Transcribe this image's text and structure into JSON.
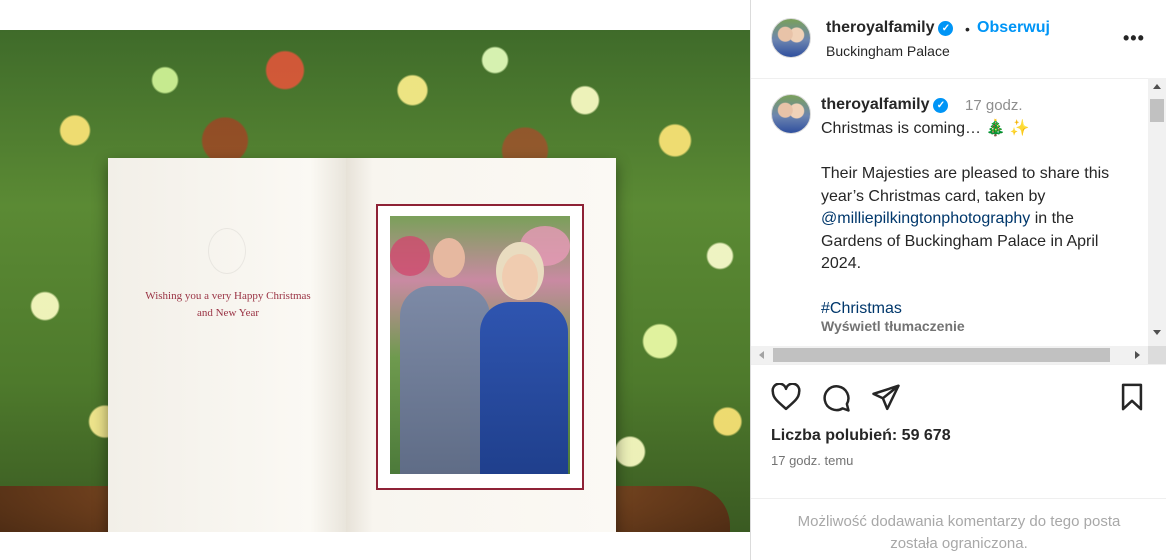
{
  "post": {
    "author": "theroyalfamily",
    "location": "Buckingham Palace",
    "follow_label": "Obserwuj",
    "dot": "•",
    "more_label": "•••",
    "verified_glyph": "✓"
  },
  "card": {
    "line1": "Wishing you a very Happy Christmas",
    "line2": "and New Year"
  },
  "caption": {
    "author": "theroyalfamily",
    "time": "17 godz.",
    "line1": "Christmas is coming… 🎄 ✨",
    "para_text": "Their Majesties are pleased to share this year’s Christmas card, taken by ",
    "mention": "@milliepilkingtonphotography",
    "para_end": " in the Gardens of Buckingham Palace in April 2024.",
    "hashtag": "#Christmas",
    "translate_label": "Wyświetl tłumaczenie"
  },
  "engagement": {
    "likes": "Liczba polubień: 59 678",
    "posted_ago": "17 godz. temu"
  },
  "comments_restricted": {
    "line1": "Możliwość dodawania komentarzy do tego posta",
    "line2": "została ograniczona."
  },
  "icons": {
    "like": "heart-icon",
    "comment": "comment-icon",
    "share": "share-icon",
    "save": "bookmark-icon"
  }
}
